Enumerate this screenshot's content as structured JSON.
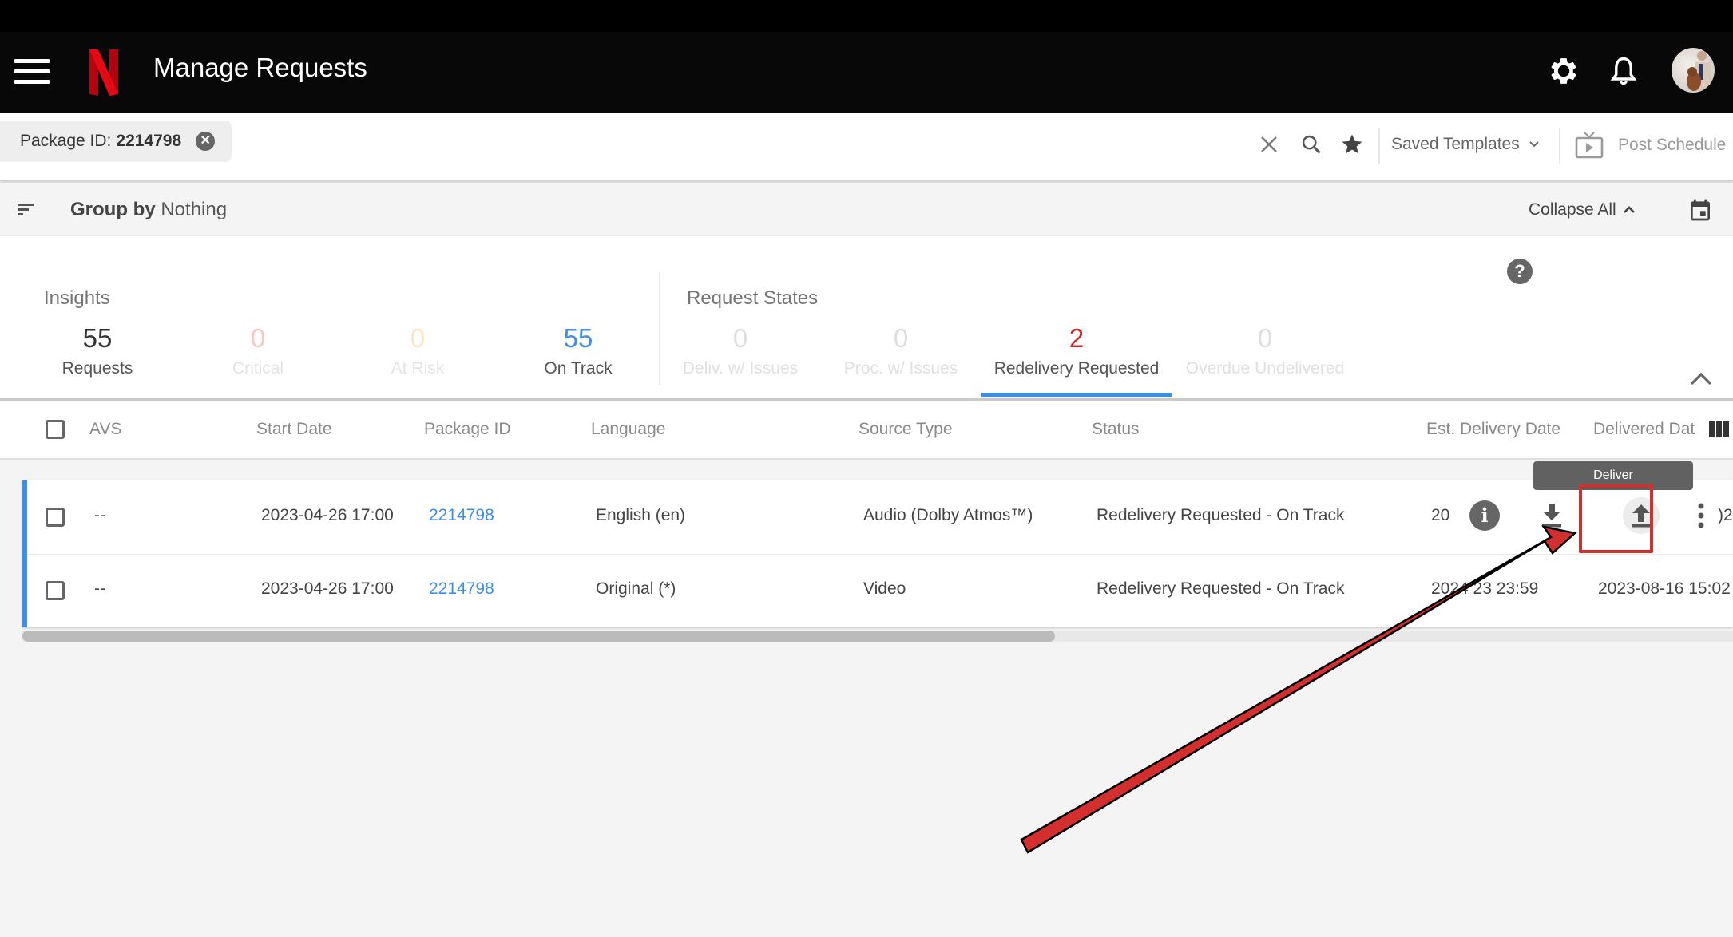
{
  "appbar": {
    "title": "Manage Requests",
    "brand_color": "#e50914",
    "icons": [
      "menu-icon",
      "settings-icon",
      "notifications-icon",
      "user-avatar"
    ]
  },
  "filterbar": {
    "chip": {
      "label": "Package ID:",
      "value": "2214798"
    },
    "saved_templates_label": "Saved Templates",
    "post_schedule_label": "Post Schedule",
    "icons": [
      "clear-icon",
      "search-icon",
      "star-icon",
      "chevron-down-icon",
      "tv-play-icon"
    ]
  },
  "groupbar": {
    "group_by_label": "Group by",
    "group_by_value": "Nothing",
    "collapse_all_label": "Collapse All"
  },
  "insights": {
    "title": "Insights",
    "stats": [
      {
        "value": "55",
        "label": "Requests",
        "color": "#333333",
        "label_color": "#555555"
      },
      {
        "value": "0",
        "label": "Critical",
        "color": "#f3c9c6",
        "label_color": "#e3e3e3"
      },
      {
        "value": "0",
        "label": "At Risk",
        "color": "#fde3c4",
        "label_color": "#e3e3e3"
      },
      {
        "value": "55",
        "label": "On Track",
        "color": "#3f8ee6",
        "label_color": "#555555"
      }
    ]
  },
  "request_states": {
    "title": "Request States",
    "stats": [
      {
        "value": "0",
        "label": "Deliv. w/ Issues",
        "color": "#dddddd",
        "label_color": "#e0e0e0"
      },
      {
        "value": "0",
        "label": "Proc. w/ Issues",
        "color": "#dddddd",
        "label_color": "#e0e0e0"
      },
      {
        "value": "2",
        "label": "Redelivery Requested",
        "color": "#c62828",
        "label_color": "#555555",
        "active": true
      },
      {
        "value": "0",
        "label": "Overdue Undelivered",
        "color": "#dddddd",
        "label_color": "#e0e0e0"
      }
    ]
  },
  "table": {
    "columns": [
      "AVS",
      "Start Date",
      "Package ID",
      "Language",
      "Source Type",
      "Status",
      "Est. Delivery Date",
      "Delivered Dat"
    ],
    "rows": [
      {
        "avs": "--",
        "start_date": "2023-04-26 17:00",
        "package_id": "2214798",
        "language": "English (en)",
        "source_type": "Audio (Dolby Atmos™)",
        "status": "Redelivery Requested - On Track",
        "est_delivery_date": "20",
        "delivered_date": ")2"
      },
      {
        "avs": "--",
        "start_date": "2023-04-26 17:00",
        "package_id": "2214798",
        "language": "Original (*)",
        "source_type": "Video",
        "status": "Redelivery Requested - On Track",
        "est_delivery_date": "2024-__-23 23:59",
        "est_delivery_date_visible": "2024 23 23:59",
        "delivered_date": "2023-08-16 15:02"
      }
    ],
    "row_actions": [
      "info-icon",
      "download-icon",
      "deliver-upload-icon",
      "more-vert-icon"
    ]
  },
  "tooltip": {
    "text": "Deliver"
  },
  "annotation": {
    "type": "red arrow pointing to Deliver button",
    "color": "#d32f2f"
  }
}
